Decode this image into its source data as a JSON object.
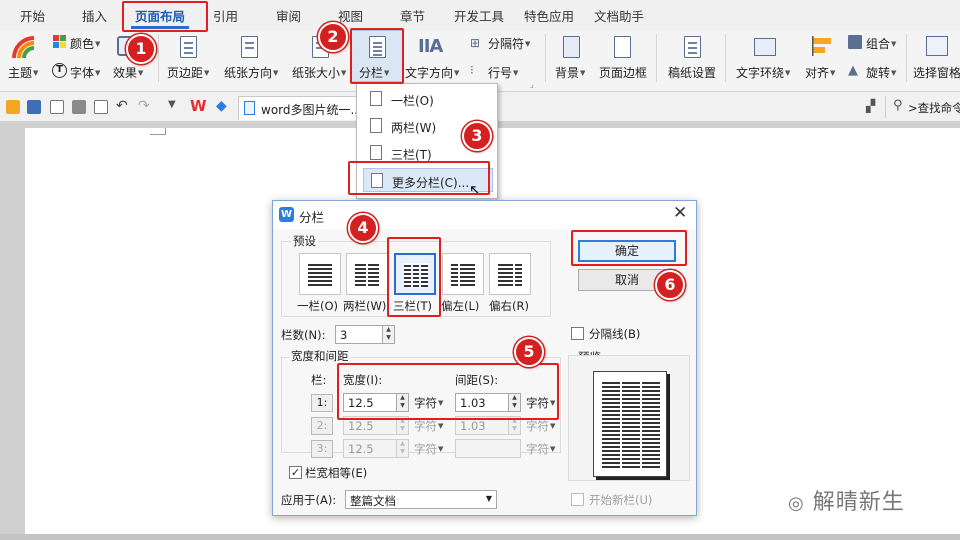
{
  "tabs": {
    "items": [
      "开始",
      "插入",
      "页面布局",
      "引用",
      "审阅",
      "视图",
      "章节",
      "开发工具",
      "特色应用",
      "文档助手"
    ],
    "active_index": 2
  },
  "ribbon": {
    "color": "颜色",
    "theme": "主题",
    "font": "字体",
    "effect": "效果",
    "margin": "页边距",
    "orientation": "纸张方向",
    "size": "纸张大小",
    "columns": "分栏",
    "text_direction": "文字方向",
    "separator": "分隔符",
    "line_number": "行号",
    "background": "背景",
    "page_border": "页面边框",
    "draft_settings": "稿纸设置",
    "text_wrap": "文字环绕",
    "align": "对齐",
    "group": "组合",
    "rotate": "旋转",
    "select_pane": "选择窗格"
  },
  "quickbar": {
    "doc_tab": "word多图片统一...",
    "search": ">查找命令"
  },
  "dropdown": {
    "items": [
      "一栏(O)",
      "两栏(W)",
      "三栏(T)",
      "更多分栏(C)..."
    ]
  },
  "dialog": {
    "title": "分栏",
    "presets_label": "预设",
    "presets": [
      "一栏(O)",
      "两栏(W)",
      "三栏(T)",
      "偏左(L)",
      "偏右(R)"
    ],
    "num_columns_label": "栏数(N):",
    "num_columns": "3",
    "separator_line": "分隔线(B)",
    "width_spacing_label": "宽度和间距",
    "col_label": "栏:",
    "width_label": "宽度(I):",
    "spacing_label": "间距(S):",
    "rows": [
      {
        "n": "1:",
        "width": "12.5",
        "spacing": "1.03"
      },
      {
        "n": "2:",
        "width": "12.5",
        "spacing": "1.03"
      },
      {
        "n": "3:",
        "width": "12.5",
        "spacing": ""
      }
    ],
    "unit": "字符",
    "equal_width": "栏宽相等(E)",
    "apply_to_label": "应用于(A):",
    "apply_to_value": "整篇文档",
    "preview_label": "预览",
    "new_column": "开始新栏(U)",
    "ok": "确定",
    "cancel": "取消"
  },
  "callouts": [
    "1",
    "2",
    "3",
    "4",
    "5",
    "6"
  ],
  "watermark": "解晴新生",
  "colors": {
    "accent": "#2b6cd0",
    "callout": "#d42020"
  }
}
